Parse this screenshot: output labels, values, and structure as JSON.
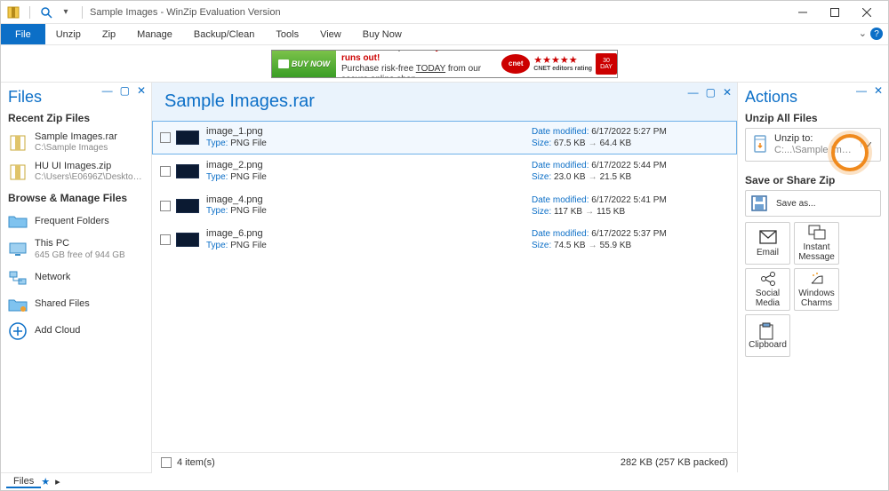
{
  "titlebar": {
    "title": "Sample Images - WinZip Evaluation Version"
  },
  "menu": [
    "File",
    "Unzip",
    "Zip",
    "Manage",
    "Backup/Clean",
    "Tools",
    "View",
    "Buy Now"
  ],
  "ad": {
    "buy": "BUY NOW",
    "line1a": "Activate WinZip ",
    "line1b": "before your trial runs out!",
    "line2a": "Purchase risk-free ",
    "line2b": "TODAY",
    "line2c": " from our secure online shop.",
    "editors": "CNET editors rating",
    "badge_top": "30",
    "badge_bot": "DAY"
  },
  "left": {
    "title": "Files",
    "recent_head": "Recent Zip Files",
    "recent": [
      {
        "name": "Sample Images.rar",
        "sub": "C:\\Sample Images"
      },
      {
        "name": "HU UI Images.zip",
        "sub": "C:\\Users\\E0696Z\\Desktop..."
      }
    ],
    "browse_head": "Browse & Manage Files",
    "browse": [
      {
        "name": "Frequent Folders",
        "sub": "",
        "icon": "folder-star"
      },
      {
        "name": "This PC",
        "sub": "645 GB free of 944 GB",
        "icon": "pc"
      },
      {
        "name": "Network",
        "sub": "",
        "icon": "network"
      },
      {
        "name": "Shared Files",
        "sub": "",
        "icon": "folder-share"
      },
      {
        "name": "Add Cloud",
        "sub": "",
        "icon": "add-cloud"
      }
    ]
  },
  "center": {
    "title": "Sample Images.rar",
    "type_label": "Type:",
    "date_label": "Date modified:",
    "size_label": "Size:",
    "files": [
      {
        "name": "image_1.png",
        "type": "PNG File",
        "date": "6/17/2022 5:27 PM",
        "size": "67.5 KB",
        "packed": "64.4 KB",
        "sel": true
      },
      {
        "name": "image_2.png",
        "type": "PNG File",
        "date": "6/17/2022 5:44 PM",
        "size": "23.0 KB",
        "packed": "21.5 KB",
        "sel": false
      },
      {
        "name": "image_4.png",
        "type": "PNG File",
        "date": "6/17/2022 5:41 PM",
        "size": "117 KB",
        "packed": "115 KB",
        "sel": false
      },
      {
        "name": "image_6.png",
        "type": "PNG File",
        "date": "6/17/2022 5:37 PM",
        "size": "74.5 KB",
        "packed": "55.9 KB",
        "sel": false
      }
    ],
    "foot_count": "4 item(s)",
    "foot_pack": "282 KB (257 KB packed)"
  },
  "right": {
    "title": "Actions",
    "unzip_head": "Unzip All Files",
    "unzip_label": "Unzip to:",
    "unzip_path": "C:...\\Sample Images",
    "share_head": "Save or Share Zip",
    "saveas": "Save as...",
    "share": [
      {
        "label": "Email",
        "icon": "email"
      },
      {
        "label": "Instant Message",
        "icon": "im"
      },
      {
        "label": "Social Media",
        "icon": "social"
      },
      {
        "label": "Windows Charms",
        "icon": "charms"
      },
      {
        "label": "Clipboard",
        "icon": "clipboard"
      }
    ]
  },
  "tabs": {
    "files": "Files"
  }
}
